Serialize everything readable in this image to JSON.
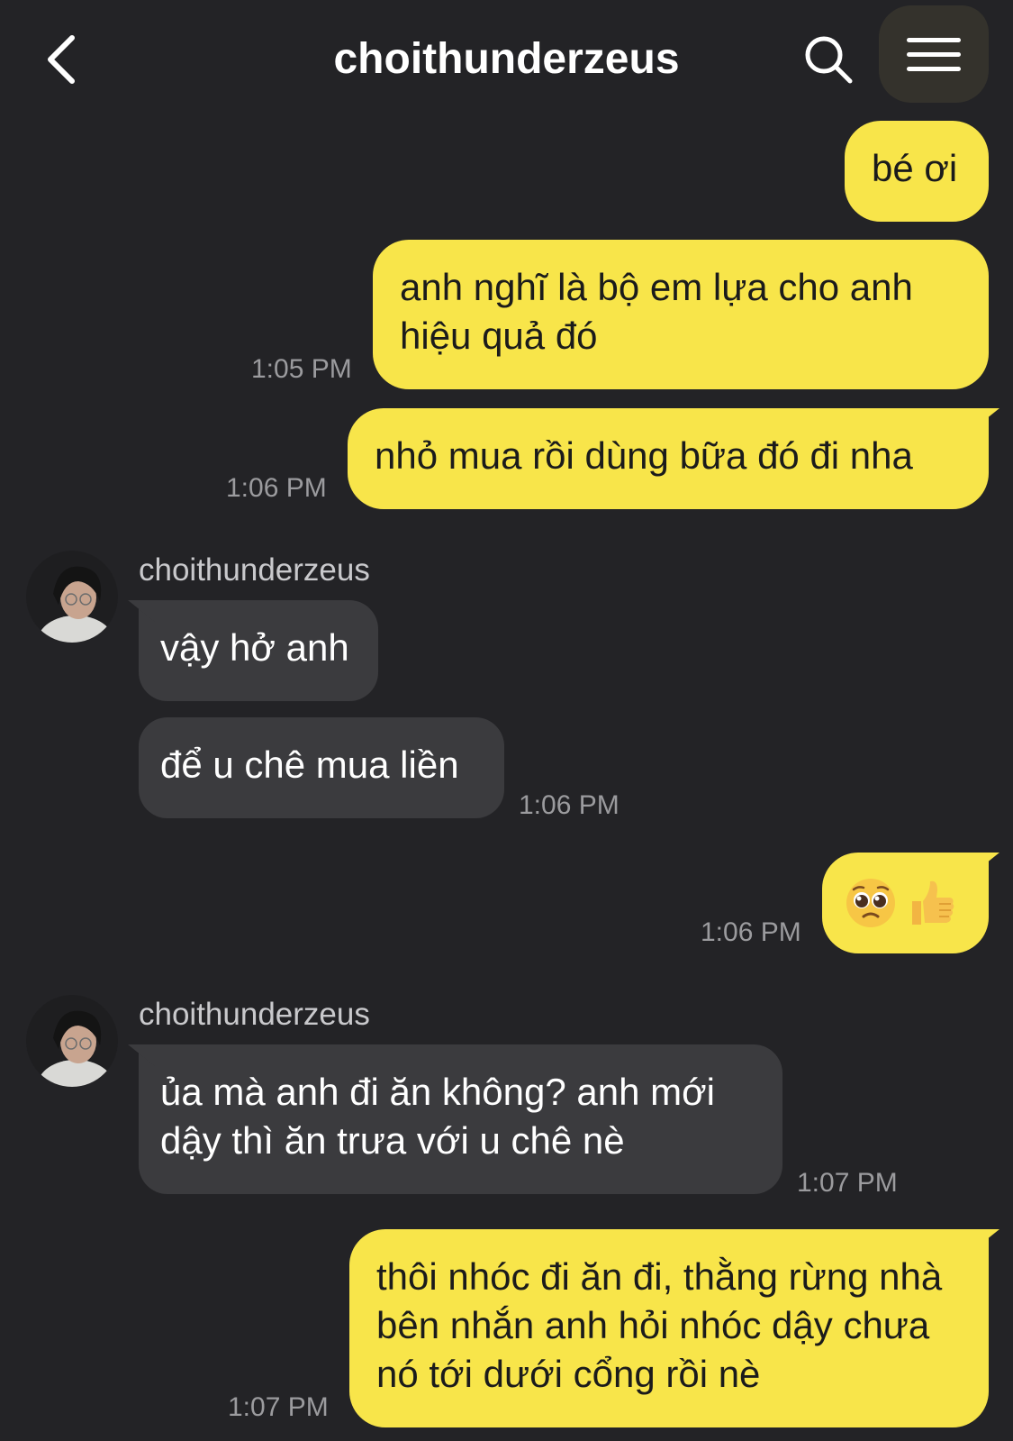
{
  "header": {
    "title": "choithunderzeus",
    "back_icon": "chevron-left-icon",
    "search_icon": "search-icon",
    "menu_icon": "hamburger-menu-icon"
  },
  "colors": {
    "background": "#232326",
    "outgoing_bubble": "#f8e54a",
    "incoming_bubble": "#3b3b3e",
    "timestamp": "#9b9b9e"
  },
  "messages": [
    {
      "direction": "out",
      "text": "bé ơi",
      "time": ""
    },
    {
      "direction": "out",
      "text": "anh nghĩ là bộ em lựa cho anh hiệu quả đó",
      "time": "1:05 PM"
    },
    {
      "direction": "out",
      "text": "nhỏ mua rồi dùng bữa đó đi nha",
      "time": "1:06 PM"
    },
    {
      "direction": "in",
      "sender": "choithunderzeus",
      "text": "vậy hở anh",
      "time": ""
    },
    {
      "direction": "in",
      "text": "để u chê mua liền",
      "time": "1:06 PM"
    },
    {
      "direction": "out",
      "emoji": [
        "pleading-face-icon",
        "thumbs-up-icon"
      ],
      "time": "1:06 PM"
    },
    {
      "direction": "in",
      "sender": "choithunderzeus",
      "text": "ủa mà anh đi ăn không? anh mới dậy thì ăn trưa với u chê nè",
      "time": "1:07 PM"
    },
    {
      "direction": "out",
      "text": "thôi nhóc đi ăn đi, thằng rừng nhà bên nhắn anh hỏi nhóc dậy chưa nó tới dưới cổng rồi nè",
      "time": "1:07 PM"
    }
  ]
}
